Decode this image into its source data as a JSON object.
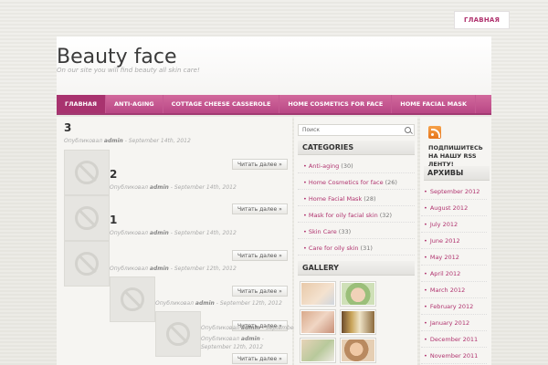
{
  "topnav": {
    "home": "ГЛАВНАЯ"
  },
  "site": {
    "title": "Beauty face",
    "description": "On our site you will find beauty all skin care!"
  },
  "mainnav": [
    "ГЛАВНАЯ",
    "ANTI-AGING",
    "COTTAGE CHEESE CASSEROLE",
    "HOME COSMETICS FOR FACE",
    "HOME FACIAL MASK"
  ],
  "posts": {
    "p1": {
      "title": "3",
      "meta_prefix": "Опубликовал",
      "author": "admin",
      "date": "- September 14th, 2012"
    },
    "p2": {
      "title": "2",
      "meta_prefix": "Опубликовал",
      "author": "admin",
      "date": "- September 14th, 2012",
      "readmore": "Читать далее »"
    },
    "p3": {
      "title": "1",
      "meta_prefix": "Опубликовал",
      "author": "admin",
      "date": "- September 14th, 2012",
      "readmore": "Читать далее »"
    },
    "p4": {
      "meta_prefix": "Опубликовал",
      "author": "admin",
      "date": "- September 12th, 2012",
      "readmore": "Читать далее »"
    },
    "p5": {
      "meta_prefix": "Опубликовал",
      "author": "admin",
      "date": "- September 12th, 2012",
      "readmore": "Читать далее »"
    },
    "p6": {
      "meta_prefix": "Опубликовал",
      "author": "admin",
      "date": "- September 12th, 2012",
      "readmore": "Читать далее »"
    },
    "p7": {
      "meta_prefix": "Опубликовал",
      "author": "admin",
      "date": "-"
    },
    "p7b": {
      "date": "September 12th, 2012",
      "readmore": "Читать далее »"
    }
  },
  "search": {
    "placeholder": "Поиск"
  },
  "categories": {
    "title": "CATEGORIES",
    "items": [
      {
        "name": "Anti-aging",
        "count": "(30)"
      },
      {
        "name": "Home Cosmetics for face",
        "count": "(26)"
      },
      {
        "name": "Home Facial Mask",
        "count": "(28)"
      },
      {
        "name": "Mask for oily facial skin",
        "count": "(32)"
      },
      {
        "name": "Skin Care",
        "count": "(33)"
      },
      {
        "name": "Care for oily skin",
        "count": "(31)"
      }
    ]
  },
  "gallery": {
    "title": "GALLERY"
  },
  "rss": {
    "text": "ПОДПИШИТЕСЬ НА НАШУ RSS ЛЕНТУ!"
  },
  "archives": {
    "title": "АРХИВЫ",
    "items": [
      "September 2012",
      "August 2012",
      "July 2012",
      "June 2012",
      "May 2012",
      "April 2012",
      "March 2012",
      "February 2012",
      "January 2012",
      "December 2011",
      "November 2011"
    ]
  },
  "colors": {
    "accent": "#b0326e",
    "nav": "#c2548f",
    "nav_active": "#a8336f"
  }
}
